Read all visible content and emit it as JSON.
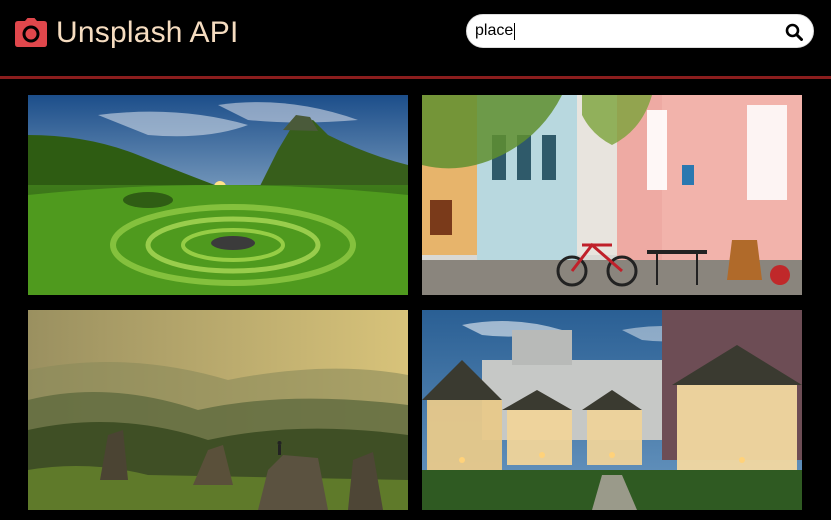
{
  "header": {
    "title": "Unsplash API",
    "logo_icon": "camera-icon",
    "brand_color": "#e0474c",
    "title_color": "#f5dcc0",
    "divider_color": "#8b1d1d"
  },
  "search": {
    "value": "place",
    "placeholder": "",
    "button_icon": "search-icon"
  },
  "photos": [
    {
      "subject": "green-valley-stone-circle-sunset"
    },
    {
      "subject": "colorful-street-cafe-bicycle"
    },
    {
      "subject": "misty-mountains-hiker-on-rock"
    },
    {
      "subject": "illuminated-garden-gazebos-dusk"
    }
  ]
}
